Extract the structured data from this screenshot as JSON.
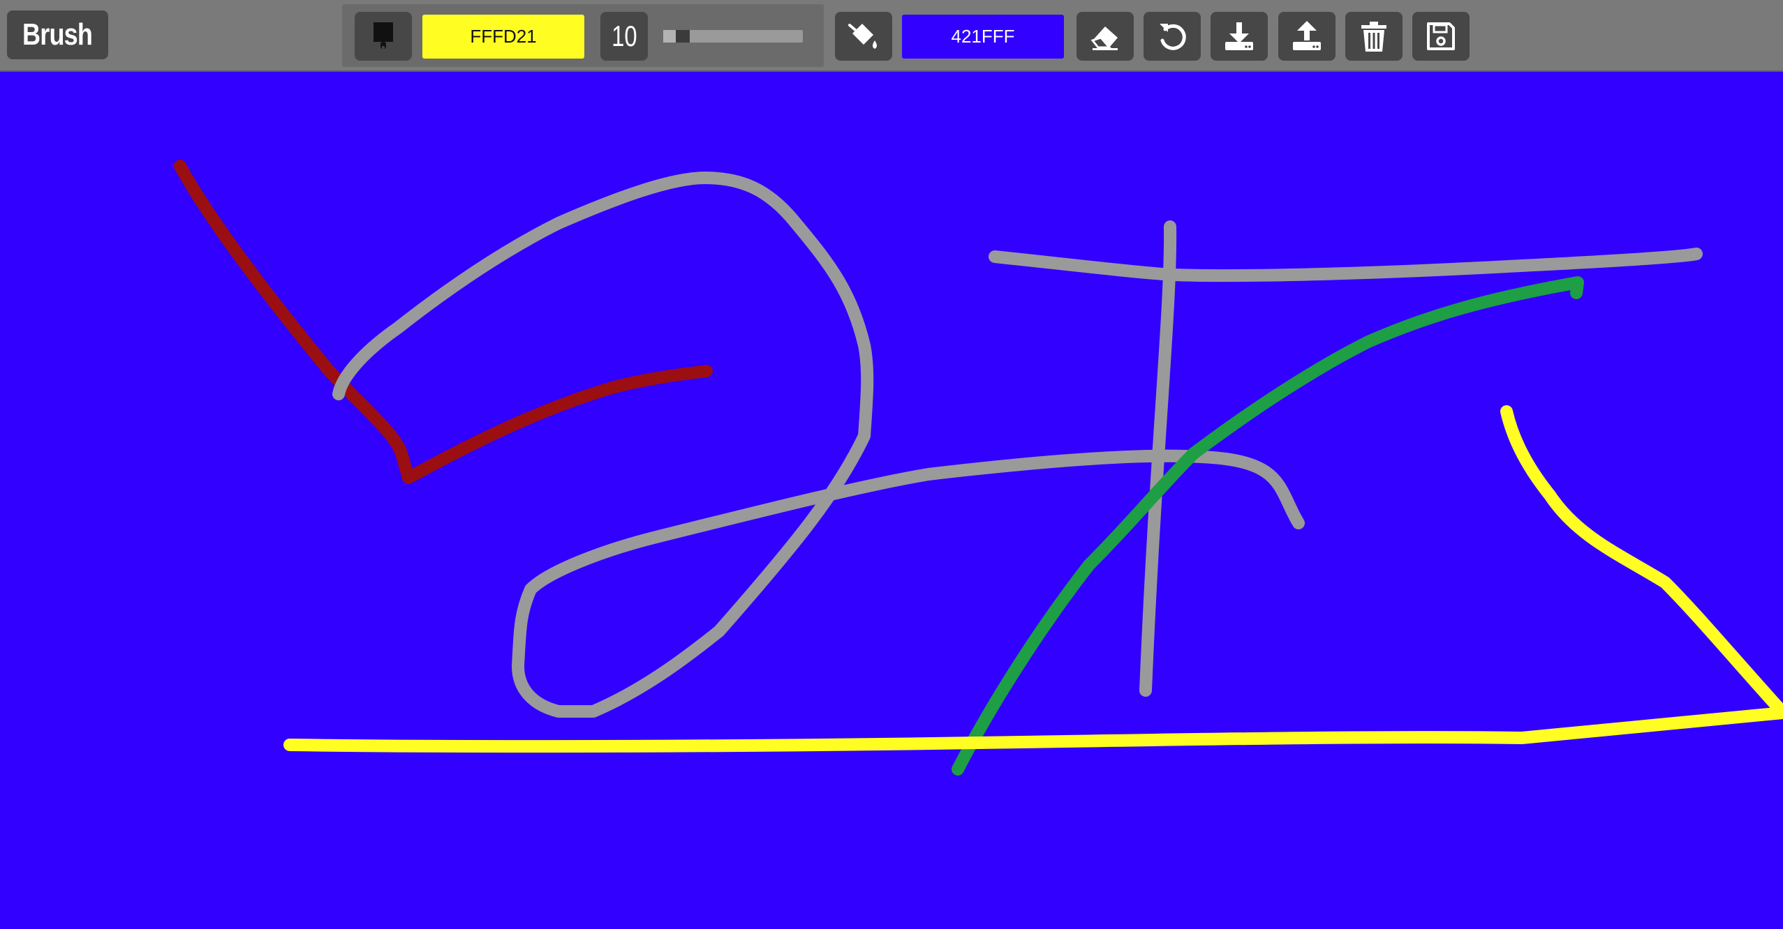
{
  "app": {
    "mode_label": "Brush"
  },
  "toolbar": {
    "brush_color": "FFFD21",
    "brush_color_hex": "#FFFD21",
    "brush_size": "10",
    "brush_size_fraction": 0.1,
    "fill_color": "421FFF",
    "fill_color_hex": "#3100FF",
    "icons": {
      "brush": "paint-brush-icon",
      "fill": "fill-bucket-icon",
      "eraser": "eraser-icon",
      "undo": "undo-icon",
      "download": "download-icon",
      "upload": "upload-icon",
      "clear": "trash-icon",
      "save": "save-icon"
    }
  },
  "canvas": {
    "background": "#3100FF",
    "stroke_colors": {
      "red": "#9B0F12",
      "gray": "#9A9A9A",
      "green": "#1E9E45",
      "yellow": "#FFFD21"
    }
  }
}
